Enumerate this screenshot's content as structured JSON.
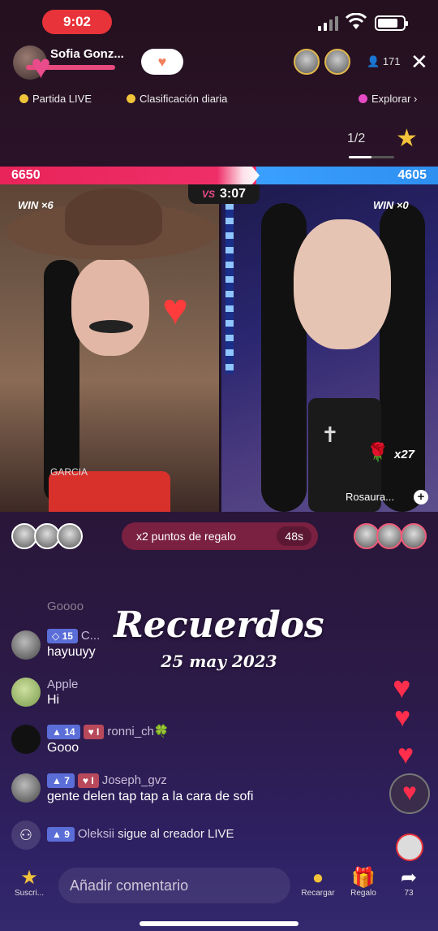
{
  "status_bar": {
    "time": "9:02"
  },
  "host": {
    "name": "Sofia Gonz..."
  },
  "viewers": {
    "count": "171",
    "badge1": "TOP 1",
    "badge2": "TOP 2"
  },
  "categories": [
    {
      "label": "Partida LIVE",
      "color": "#f0c43a"
    },
    {
      "label": "Clasificación diaria",
      "color": "#f0c43a"
    },
    {
      "label": "Explorar",
      "color": "#e64ac4"
    }
  ],
  "page_indicator": "1/2",
  "battle": {
    "score_left": "6650",
    "score_right": "4605",
    "timer": "3:07",
    "win_left": "WIN ×6",
    "win_right": "WIN ×0",
    "left_label": "GARCIA",
    "right_name": "Rosaura...",
    "gift_count": "x27"
  },
  "points_banner": {
    "label": "x2 puntos de regalo",
    "time": "48s"
  },
  "overlay": {
    "title": "Recuerdos",
    "date": "25 may 2023"
  },
  "chat": [
    {
      "faded": "Goooo"
    },
    {
      "level": "15",
      "name": "C...",
      "message": "hayuuyy"
    },
    {
      "name": "Apple",
      "message": "Hi"
    },
    {
      "level": "14",
      "fan": "I",
      "name": "ronni_ch🍀",
      "message": "Gooo"
    },
    {
      "level": "7",
      "fan": "I",
      "name": "Joseph_gvz",
      "message": "gente delen tap tap a la cara de sofi"
    },
    {
      "level": "9",
      "name": "Oleksii",
      "message": "sigue al creador LIVE"
    }
  ],
  "toolbar": {
    "subscribe_label": "Suscri...",
    "comment_placeholder": "Añadir comentario",
    "recharge_label": "Recargar",
    "gift_label": "Regalo",
    "share_count": "73"
  }
}
